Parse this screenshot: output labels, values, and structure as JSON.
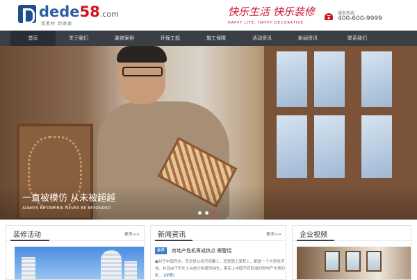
{
  "header": {
    "logo_name_main": "dede",
    "logo_name_num": "58",
    "logo_domain": ".com",
    "logo_sub": "找素材  到德德",
    "slogan_cn_a": "快乐生活",
    "slogan_cn_b": "快乐装修",
    "slogan_en": "HAPPY LIFE, HAPPY DECORATIVE",
    "hotline_label": "服务热线",
    "hotline_number": "400-600-9999"
  },
  "nav": {
    "items": [
      {
        "label": "首页",
        "active": true
      },
      {
        "label": "关于我们",
        "active": false
      },
      {
        "label": "装修案例",
        "active": false
      },
      {
        "label": "环保工程",
        "active": false
      },
      {
        "label": "施工保障",
        "active": false
      },
      {
        "label": "活动资讯",
        "active": false
      },
      {
        "label": "新闻资讯",
        "active": false
      },
      {
        "label": "联系我们",
        "active": false
      }
    ]
  },
  "banner": {
    "caption_cn": "一直被模仿  从未被超越",
    "caption_en": "ALWAYS BE COPIED, NEVER BE BEYONDED",
    "slides": 3,
    "active_slide": 3
  },
  "sections": {
    "activities": {
      "title": "装修活动",
      "more": "更多>>"
    },
    "news": {
      "title": "新闻资讯",
      "more": "更多>>",
      "tag": "推荐",
      "headline": "房地产危机再成热点 需警惕",
      "body": "●对于中国而言，无论是从经济规模上，还是国土面积上，都是一个大型经济体，并且由于历史上在统计制度的缺失，事实上中国不同区域的房地产市场的影... ",
      "detail_link": "[详情]"
    },
    "video": {
      "title": "企业视频"
    }
  },
  "colors": {
    "nav_bg": "#3a3f46",
    "brand_blue": "#2b5fa3",
    "brand_red": "#c8102e",
    "active_dot": "#d43a6e"
  }
}
